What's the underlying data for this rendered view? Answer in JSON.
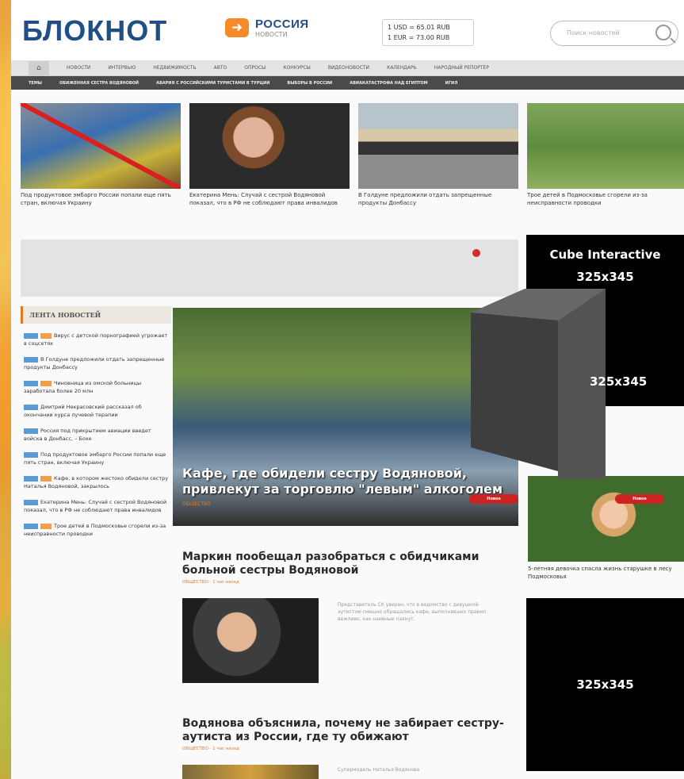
{
  "header": {
    "logo_text": "БЛОКНОТ",
    "region_title": "РОССИЯ",
    "region_sub": "НОВОСТИ",
    "rates_line1": "1 USD = 65.01 RUB",
    "rates_line2": "1 EUR = 73.00 RUB",
    "search_placeholder": "Поиск новостей"
  },
  "nav_main": [
    "НОВОСТИ",
    "ИНТЕРВЬЮ",
    "НЕДВИЖИМОСТЬ",
    "АВТО",
    "ОПРОСЫ",
    "КОНКУРСЫ",
    "ВИДЕОНОВОСТИ",
    "КАЛЕНДАРЬ",
    "НАРОДНЫЙ РЕПОРТЕР"
  ],
  "nav_home": "⌂",
  "nav_topics": [
    "ТЕМЫ",
    "ОБИЖЕННАЯ СЕСТРА ВОДЯНОВОЙ",
    "АВАРИЯ С РОССИЙСКИМИ ТУРИСТАМИ В ТУРЦИИ",
    "ВЫБОРЫ В РОССИИ",
    "АВИАКАТАСТРОФА НАД ЕГИПТОМ",
    "ИГИЛ"
  ],
  "top_cards": [
    {
      "caption": "Под продуктовое эмбарго России попали еще пять стран, включая Украину"
    },
    {
      "caption": "Екатерина Мень: Случай с сестрой Водяновой показал, что в РФ не соблюдают права инвалидов"
    },
    {
      "caption": "В Голдуне предложили отдать запрещенные продукты Донбассу"
    },
    {
      "caption": "Трое детей в Подмосковье сгорели из-за неисправности проводки"
    }
  ],
  "ad_top": {
    "line1": "Cube Interactive",
    "line2": "325x345"
  },
  "cube_label": "325x345",
  "ad_bottom": "325x345",
  "side_caption": "5-летняя девочка спасла жизнь старушке в лесу Подмосковья",
  "ribbon": "Новое",
  "feed": {
    "heading": "ЛЕНТА НОВОСТЕЙ",
    "items": [
      "Вирус с детской порнографией угрожает в соцсетях",
      "В Голдуне предложили отдать запрещенные продукты Донбассу",
      "Чиновница из омской больницы заработала более 20 млн",
      "Дмитрий Некрасовский рассказал об окончании курса лучевой терапии",
      "Россия под прикрытием авиации введет войска в Донбасс, – Бохе",
      "Под продуктовое эмбарго России попали еще пять стран, включая Украину",
      "Кафе, в котором жестоко обидели сестру Наталья Водяновой, закрылось",
      "Екатерина Мень: Случай с сестрой Водяновой показал, что в РФ не соблюдают права инвалидов",
      "Трое детей в Подмосковье сгорели из-за неисправности проводки"
    ]
  },
  "main_story": {
    "title": "Кафе, где обидели сестру Водяновой, привлекут за торговлю \"левым\" алкоголем",
    "section": "ОБЩЕСТВО"
  },
  "articles": [
    {
      "title": "Маркин пообещал разобраться с обидчиками больной сестры Водяновой",
      "meta": "ОБЩЕСТВО · 1 час назад",
      "text": "Представитель СК уверен, что в ведомство с девушкой-аутистом смешно обращались кафе, выполнявших правил вежливо, как наивные пахнут."
    },
    {
      "title": "Водянова объяснила, почему не забирает сестру-аутиста из России, где ту обижают",
      "meta": "ОБЩЕСТВО · 1 час назад",
      "text": "Супермодель Наталья Водянова"
    }
  ]
}
